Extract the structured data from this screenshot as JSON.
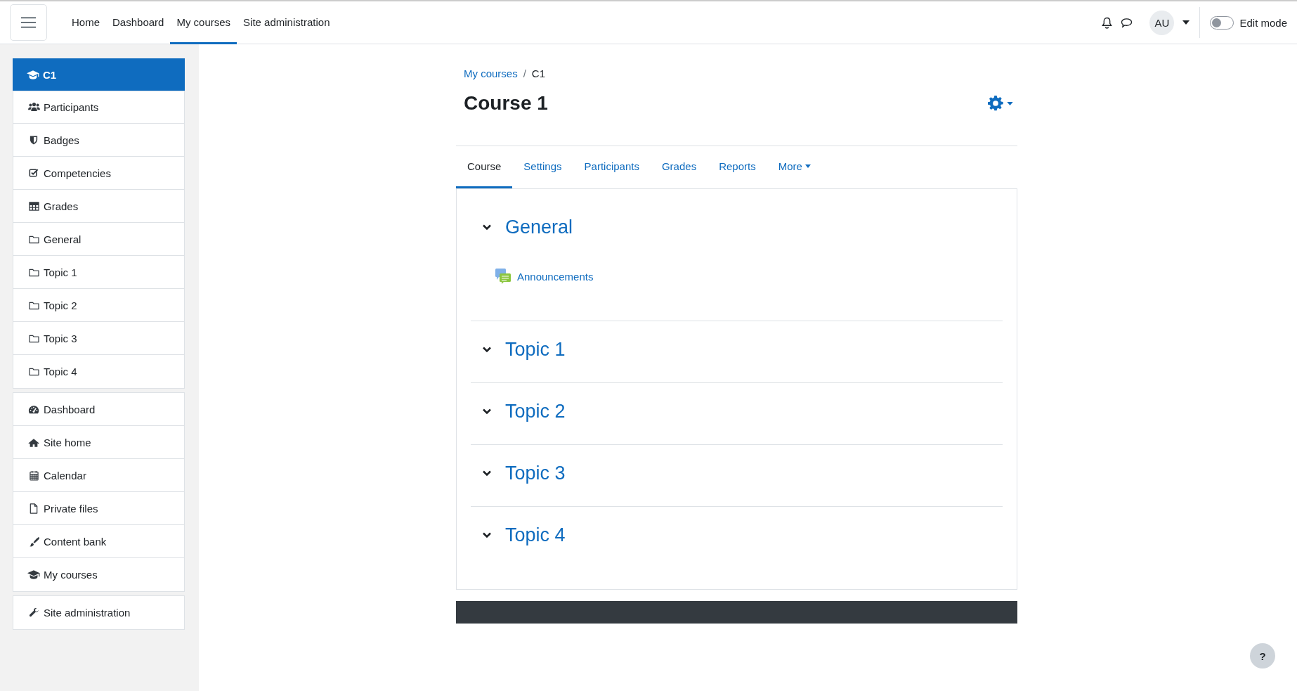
{
  "navbar": {
    "nav": [
      {
        "label": "Home",
        "selected": false
      },
      {
        "label": "Dashboard",
        "selected": false
      },
      {
        "label": "My courses",
        "selected": true
      },
      {
        "label": "Site administration",
        "selected": false
      }
    ],
    "avatar": "AU",
    "edit_mode": {
      "label": "Edit mode",
      "on": false
    }
  },
  "sidebar": {
    "groups": [
      {
        "items": [
          {
            "label": "C1",
            "kind": "course",
            "selected": true
          },
          {
            "label": "Participants",
            "kind": "participants",
            "selected": false
          },
          {
            "label": "Badges",
            "kind": "badges",
            "selected": false
          },
          {
            "label": "Competencies",
            "kind": "competencies",
            "selected": false
          },
          {
            "label": "Grades",
            "kind": "grades",
            "selected": false
          },
          {
            "label": "General",
            "kind": "section",
            "selected": false
          },
          {
            "label": "Topic 1",
            "kind": "section",
            "selected": false
          },
          {
            "label": "Topic 2",
            "kind": "section",
            "selected": false
          },
          {
            "label": "Topic 3",
            "kind": "section",
            "selected": false
          },
          {
            "label": "Topic 4",
            "kind": "section",
            "selected": false
          }
        ]
      },
      {
        "items": [
          {
            "label": "Dashboard",
            "kind": "dashboard",
            "selected": false
          },
          {
            "label": "Site home",
            "kind": "home",
            "selected": false
          },
          {
            "label": "Calendar",
            "kind": "calendar",
            "selected": false
          },
          {
            "label": "Private files",
            "kind": "files",
            "selected": false
          },
          {
            "label": "Content bank",
            "kind": "content-bank",
            "selected": false
          },
          {
            "label": "My courses",
            "kind": "courses",
            "selected": false
          }
        ]
      },
      {
        "items": [
          {
            "label": "Site administration",
            "kind": "admin",
            "selected": false
          }
        ]
      }
    ]
  },
  "breadcrumb": [
    {
      "label": "My courses",
      "kind": "link"
    },
    {
      "label": "/",
      "kind": "separator"
    },
    {
      "label": "C1",
      "kind": "current"
    }
  ],
  "page_title": "Course 1",
  "tabs": [
    {
      "label": "Course",
      "kind": "tab",
      "selected": true
    },
    {
      "label": "Settings",
      "kind": "tab",
      "selected": false
    },
    {
      "label": "Participants",
      "kind": "tab",
      "selected": false
    },
    {
      "label": "Grades",
      "kind": "tab",
      "selected": false
    },
    {
      "label": "Reports",
      "kind": "tab",
      "selected": false
    },
    {
      "label": "More",
      "kind": "menu",
      "selected": false
    }
  ],
  "sections": [
    {
      "title": "General",
      "expanded": true,
      "activities": [
        {
          "label": "Announcements"
        }
      ]
    },
    {
      "title": "Topic 1",
      "expanded": true
    },
    {
      "title": "Topic 2",
      "expanded": true
    },
    {
      "title": "Topic 3",
      "expanded": true
    },
    {
      "title": "Topic 4",
      "expanded": true
    }
  ],
  "help_button": "?"
}
